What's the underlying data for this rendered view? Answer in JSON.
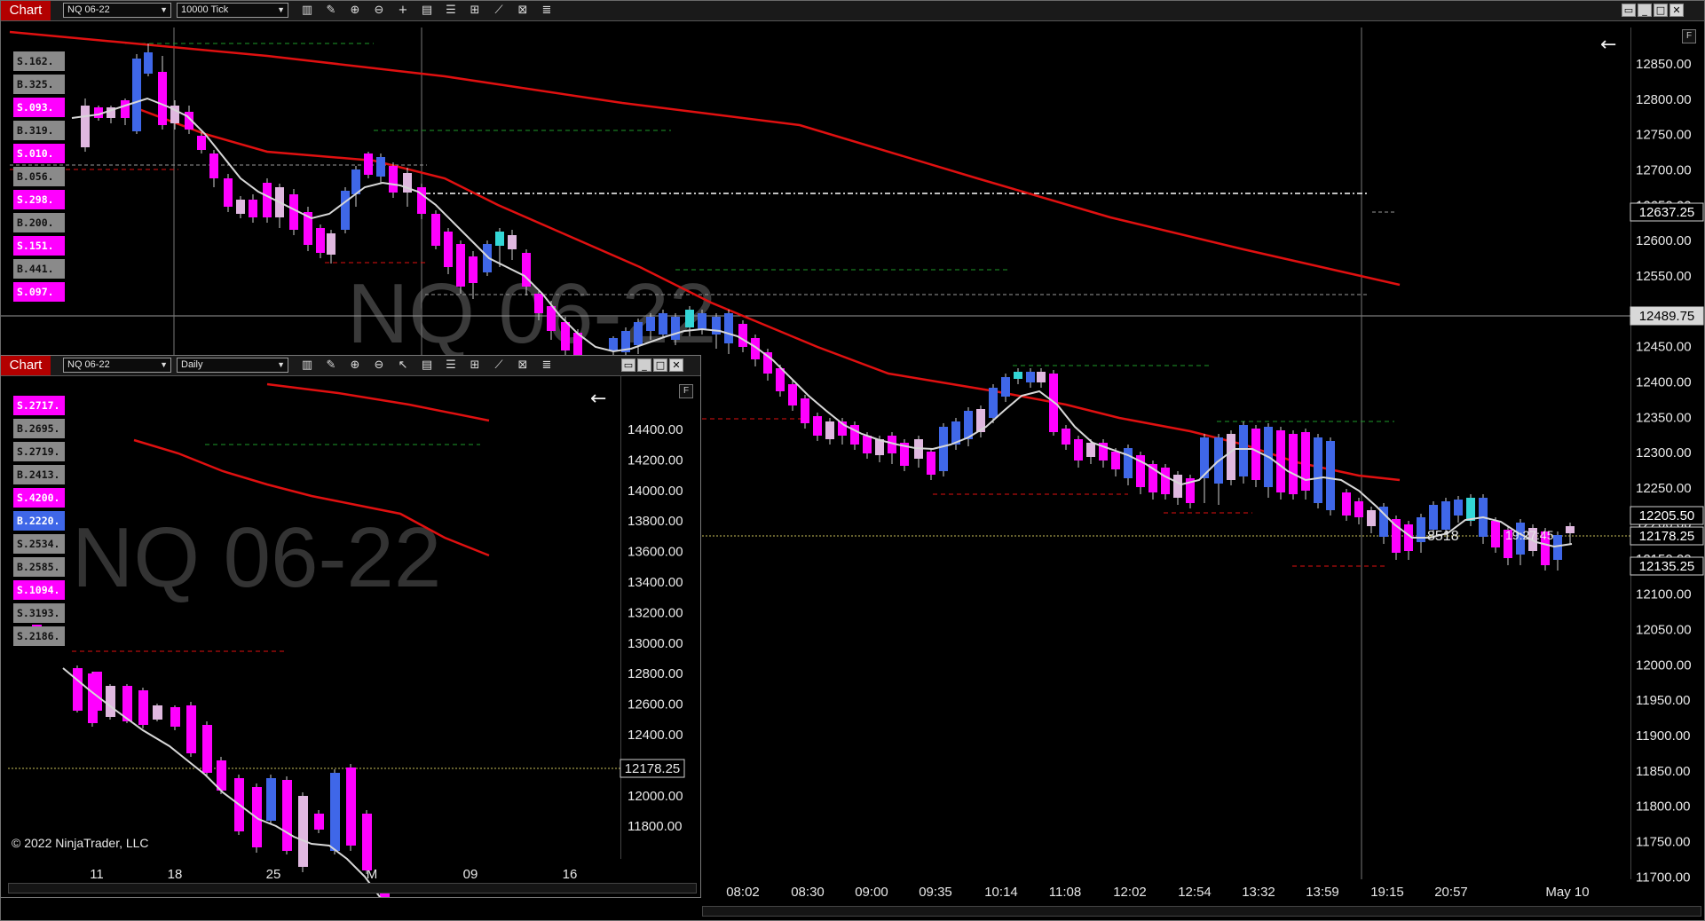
{
  "main_window": {
    "tab_label": "Chart",
    "instrument": "NQ 06-22",
    "interval": "10000 Tick",
    "watermark": "NQ 06-22",
    "price_axis": [
      "12850.00",
      "12800.00",
      "12750.00",
      "12700.00",
      "12650.00",
      "12600.00",
      "12550.00",
      "12500.00",
      "12450.00",
      "12400.00",
      "12350.00",
      "12300.00",
      "12250.00",
      "12200.00",
      "12150.00",
      "12100.00",
      "12050.00",
      "12000.00",
      "11950.00",
      "11900.00",
      "11850.00",
      "11800.00",
      "11750.00",
      "11700.00"
    ],
    "price_markers": [
      {
        "label": "12637.25",
        "style": "box"
      },
      {
        "label": "12489.75",
        "style": "grey"
      },
      {
        "label": "12205.50",
        "style": "box"
      },
      {
        "label": "12178.25",
        "style": "box"
      },
      {
        "label": "12135.25",
        "style": "box"
      }
    ],
    "time_axis": [
      "08:02",
      "08:30",
      "09:00",
      "09:35",
      "10:14",
      "11:08",
      "12:02",
      "12:54",
      "13:32",
      "13:59",
      "19:15",
      "20:57",
      "May 10"
    ],
    "volume_label": "8518",
    "time_label": "19:27:45",
    "ladder": [
      {
        "text": "S.162.",
        "kind": "buy"
      },
      {
        "text": "B.325.",
        "kind": "buy"
      },
      {
        "text": "S.093.",
        "kind": "sell"
      },
      {
        "text": "B.319.",
        "kind": "buy"
      },
      {
        "text": "S.010.",
        "kind": "sell"
      },
      {
        "text": "B.056.",
        "kind": "buy"
      },
      {
        "text": "S.298.",
        "kind": "sell"
      },
      {
        "text": "B.200.",
        "kind": "buy"
      },
      {
        "text": "S.151.",
        "kind": "sell"
      },
      {
        "text": "B.441.",
        "kind": "buy"
      },
      {
        "text": "S.097.",
        "kind": "sell"
      }
    ],
    "f_button": "F",
    "back_icon": "left-arrow-icon"
  },
  "daily_window": {
    "tab_label": "Chart",
    "instrument": "NQ 06-22",
    "interval": "Daily",
    "watermark": "NQ 06-22",
    "price_axis": [
      "14400.00",
      "14200.00",
      "14000.00",
      "13800.00",
      "13600.00",
      "13400.00",
      "13200.00",
      "13000.00",
      "12800.00",
      "12600.00",
      "12400.00",
      "12200.00",
      "12000.00",
      "11800.00"
    ],
    "price_marker": "12178.25",
    "date_axis": [
      "11",
      "18",
      "25",
      "M",
      "09",
      "16"
    ],
    "ladder": [
      {
        "text": "S.2717.",
        "kind": "sell"
      },
      {
        "text": "B.2695.",
        "kind": "buy"
      },
      {
        "text": "S.2719.",
        "kind": "sellgrey"
      },
      {
        "text": "B.2413.",
        "kind": "buy"
      },
      {
        "text": "S.4200.",
        "kind": "sell"
      },
      {
        "text": "B.2220.",
        "kind": "buyblue"
      },
      {
        "text": "S.2534.",
        "kind": "sellgrey"
      },
      {
        "text": "B.2585.",
        "kind": "buy"
      },
      {
        "text": "S.1094.",
        "kind": "sell"
      },
      {
        "text": "S.3193.",
        "kind": "sellgrey"
      },
      {
        "text": "S.2186.",
        "kind": "sellgrey"
      }
    ],
    "copyright": "© 2022 NinjaTrader, LLC",
    "f_button": "F",
    "back_icon": "left-arrow-icon"
  },
  "colors": {
    "bull_strong": "#3f67e8",
    "bull_cyan": "#00c8ff",
    "bear_strong": "#ff00ff",
    "bear_light": "#e0b8e0",
    "ma_slow": "#e01010",
    "ma_fast": "#d8d8d8"
  }
}
